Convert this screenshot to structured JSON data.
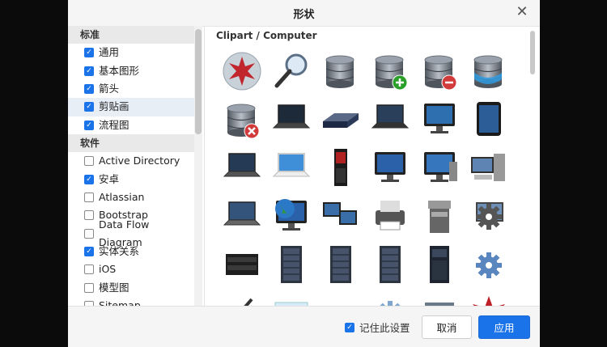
{
  "dialog": {
    "title": "形状",
    "close_icon": "close-icon"
  },
  "sidebar": {
    "sections": [
      {
        "header": "标准",
        "items": [
          {
            "label": "通用",
            "checked": true,
            "selected": false
          },
          {
            "label": "基本图形",
            "checked": true,
            "selected": false
          },
          {
            "label": "箭头",
            "checked": true,
            "selected": false
          },
          {
            "label": "剪贴画",
            "checked": true,
            "selected": true
          },
          {
            "label": "流程图",
            "checked": true,
            "selected": false
          }
        ]
      },
      {
        "header": "软件",
        "items": [
          {
            "label": "Active Directory",
            "checked": false,
            "selected": false
          },
          {
            "label": "安卓",
            "checked": true,
            "selected": false
          },
          {
            "label": "Atlassian",
            "checked": false,
            "selected": false
          },
          {
            "label": "Bootstrap",
            "checked": false,
            "selected": false
          },
          {
            "label": "Data Flow Diagram",
            "checked": false,
            "selected": false
          },
          {
            "label": "实体关系",
            "checked": true,
            "selected": false
          },
          {
            "label": "iOS",
            "checked": false,
            "selected": false
          },
          {
            "label": "模型图",
            "checked": false,
            "selected": false
          },
          {
            "label": "Sitemap",
            "checked": false,
            "selected": false
          }
        ]
      }
    ]
  },
  "main": {
    "group_title": "Clipart / Computer",
    "icons": [
      "virus-icon",
      "magnifier-icon",
      "database-icon",
      "database-add-icon",
      "database-remove-icon",
      "database-sync-icon",
      "database-error-icon",
      "laptop-icon",
      "network-device-icon",
      "laptop-dark-icon",
      "monitor-icon",
      "tablet-icon",
      "netbook-icon",
      "laptop-white-icon",
      "server-tower-icon",
      "lcd-monitor-icon",
      "desktop-computer-icon",
      "workstation-icon",
      "notebook-icon",
      "globe-monitor-icon",
      "dual-monitors-icon",
      "printer-icon",
      "copier-icon",
      "workstation-settings-icon",
      "rack-server-icon",
      "server-cabinet-icon",
      "server-rack-icon",
      "server-rack-2-icon",
      "server-tower-2-icon",
      "gears-icon",
      "pen-icon",
      "paper-icon",
      "mouse-icon",
      "settings-icon",
      "box-icon",
      "virus-red-icon"
    ]
  },
  "footer": {
    "remember_label": "记住此设置",
    "remember_checked": true,
    "cancel_label": "取消",
    "apply_label": "应用"
  },
  "colors": {
    "accent": "#1a73e8"
  }
}
